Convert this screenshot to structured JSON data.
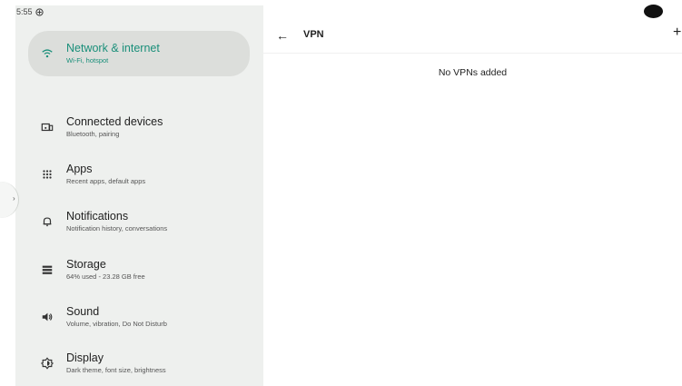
{
  "status_bar": {
    "time": "5:55"
  },
  "sidebar": {
    "items": [
      {
        "title": "Network & internet",
        "subtitle": "Wi-Fi, hotspot",
        "icon": "wifi-icon",
        "selected": true
      },
      {
        "title": "Connected devices",
        "subtitle": "Bluetooth, pairing",
        "icon": "devices-icon"
      },
      {
        "title": "Apps",
        "subtitle": "Recent apps, default apps",
        "icon": "apps-grid-icon"
      },
      {
        "title": "Notifications",
        "subtitle": "Notification history, conversations",
        "icon": "bell-icon"
      },
      {
        "title": "Storage",
        "subtitle": "64% used - 23.28 GB free",
        "icon": "storage-icon"
      },
      {
        "title": "Sound",
        "subtitle": "Volume, vibration, Do Not Disturb",
        "icon": "speaker-icon"
      },
      {
        "title": "Display",
        "subtitle": "Dark theme, font size, brightness",
        "icon": "brightness-icon"
      }
    ]
  },
  "header": {
    "back": "←",
    "title": "VPN",
    "add": "+"
  },
  "main": {
    "empty_message": "No VPNs added"
  },
  "colors": {
    "accent": "#1a8f7a",
    "selected_bg": "#dcdedb",
    "sidebar_bg": "#eef0ee"
  }
}
